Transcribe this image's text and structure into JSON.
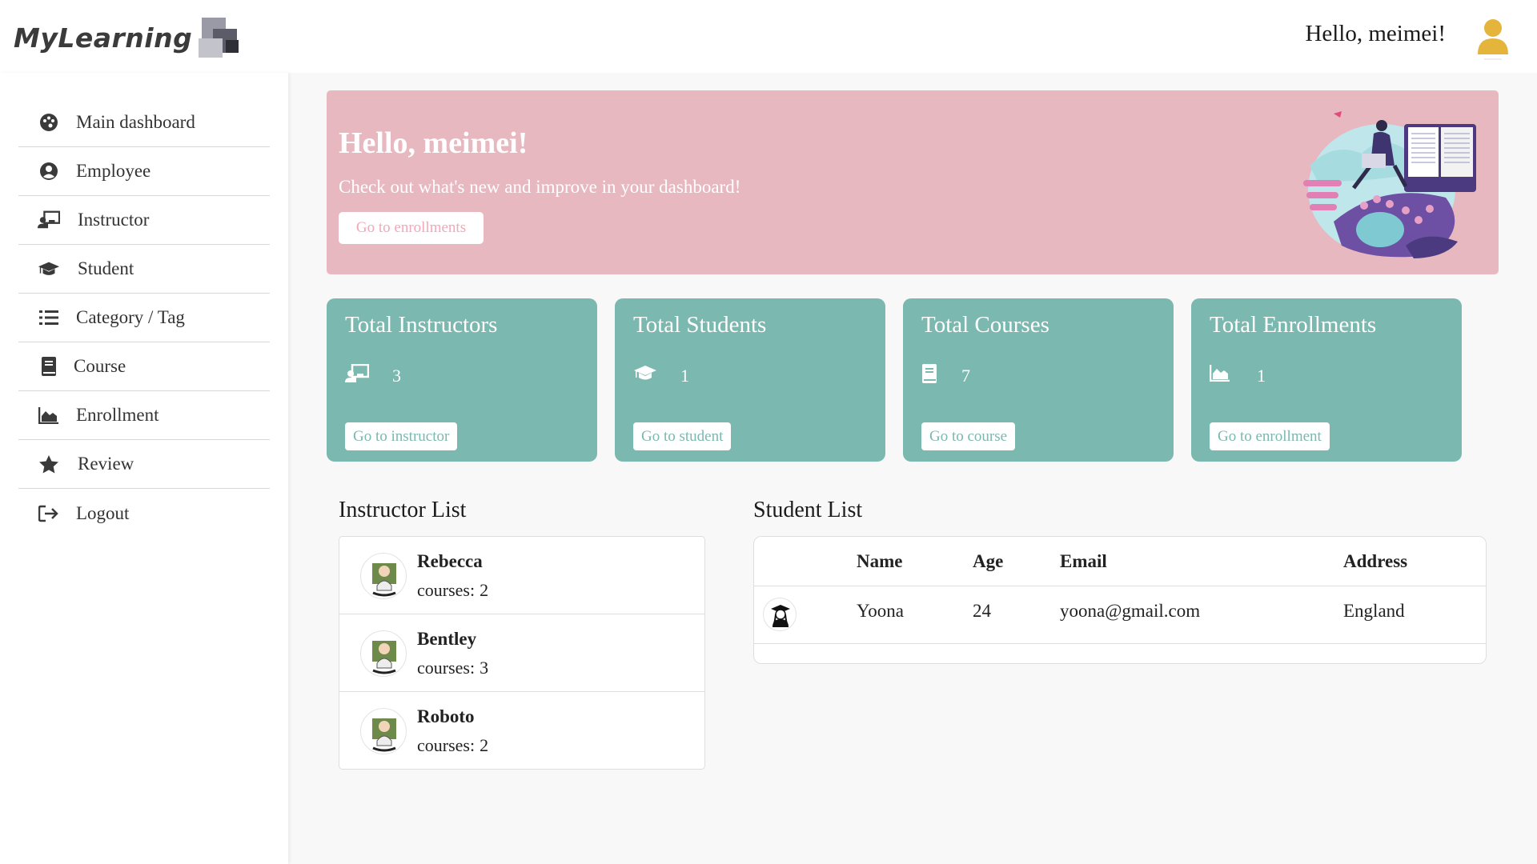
{
  "brand": {
    "logo_text": "MyLearning"
  },
  "header": {
    "greeting": "Hello, meimei!",
    "avatar_color": "#e5b43a"
  },
  "sidebar": {
    "items": [
      {
        "label": "Main dashboard",
        "icon": "palette-icon"
      },
      {
        "label": "Employee",
        "icon": "user-circle-icon"
      },
      {
        "label": "Instructor",
        "icon": "chalkboard-teacher-icon"
      },
      {
        "label": "Student",
        "icon": "graduation-cap-icon"
      },
      {
        "label": "Category / Tag",
        "icon": "list-icon"
      },
      {
        "label": "Course",
        "icon": "book-icon"
      },
      {
        "label": "Enrollment",
        "icon": "area-chart-icon"
      },
      {
        "label": "Review",
        "icon": "star-icon"
      },
      {
        "label": "Logout",
        "icon": "sign-out-icon"
      }
    ]
  },
  "hero": {
    "title": "Hello,  meimei!",
    "subtitle": "Check out what's new and improve in your dashboard!",
    "button": "Go to enrollments",
    "background": "#e7b8bf"
  },
  "stats": [
    {
      "title": "Total Instructors",
      "value": "3",
      "button": "Go to instructor",
      "icon": "chalkboard-teacher-icon"
    },
    {
      "title": "Total Students",
      "value": "1",
      "button": "Go to student",
      "icon": "graduation-cap-icon"
    },
    {
      "title": "Total Courses",
      "value": "7",
      "button": "Go to course",
      "icon": "book-icon"
    },
    {
      "title": "Total Enrollments",
      "value": "1",
      "button": "Go to enrollment",
      "icon": "area-chart-icon"
    }
  ],
  "stat_color": "#7bb8af",
  "instructor_list": {
    "title": "Instructor List",
    "courses_label": "courses:",
    "items": [
      {
        "name": "Rebecca",
        "courses": "2"
      },
      {
        "name": "Bentley",
        "courses": "3"
      },
      {
        "name": "Roboto",
        "courses": "2"
      }
    ]
  },
  "student_list": {
    "title": "Student List",
    "columns": [
      "Name",
      "Age",
      "Email",
      "Address"
    ],
    "rows": [
      {
        "name": "Yoona",
        "age": "24",
        "email": "yoona@gmail.com",
        "address": "England"
      }
    ]
  }
}
